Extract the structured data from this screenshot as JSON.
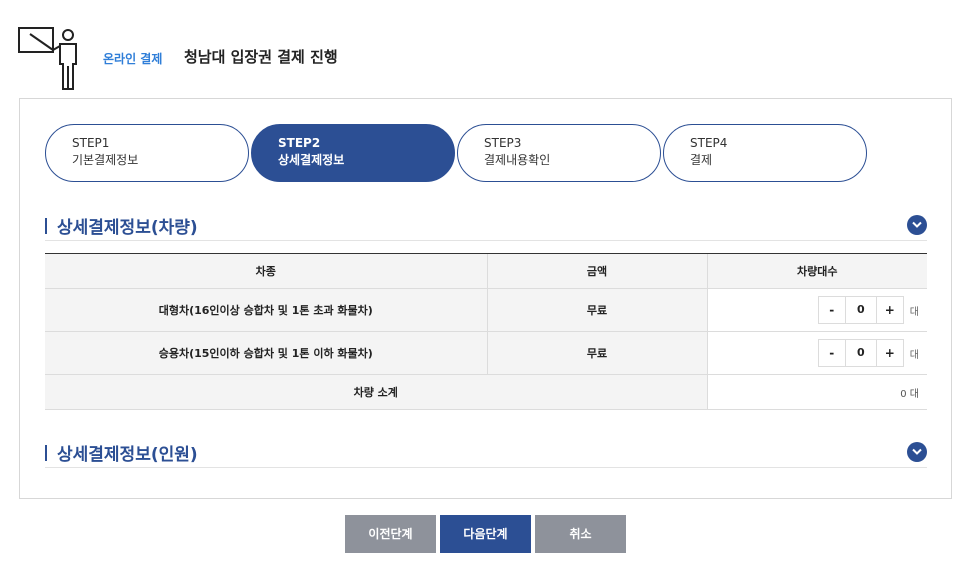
{
  "header": {
    "crumb": "온라인 결제",
    "title": "청남대 입장권 결제 진행"
  },
  "steps": [
    {
      "num": "STEP1",
      "name": "기본결제정보",
      "active": false
    },
    {
      "num": "STEP2",
      "name": "상세결제정보",
      "active": true
    },
    {
      "num": "STEP3",
      "name": "결제내용확인",
      "active": false
    },
    {
      "num": "STEP4",
      "name": "결제",
      "active": false
    }
  ],
  "vehicle_section": {
    "title": "상세결제정보(차량)",
    "columns": [
      "차종",
      "금액",
      "차량대수"
    ],
    "rows": [
      {
        "type": "대형차(16인이상 승합차 및 1톤 초과 화물차)",
        "price": "무료",
        "count": "0",
        "unit": "대"
      },
      {
        "type": "승용차(15인이하 승합차 및 1톤 이하 화물차)",
        "price": "무료",
        "count": "0",
        "unit": "대"
      }
    ],
    "subtotal_label": "차량 소계",
    "subtotal_value": "0 대",
    "minus": "-",
    "plus": "+"
  },
  "person_section": {
    "title": "상세결제정보(인원)"
  },
  "actions": {
    "prev": "이전단계",
    "next": "다음단계",
    "cancel": "취소"
  },
  "colors": {
    "primary": "#2c4f94",
    "link": "#2f7ed8",
    "gray_button": "#8e929b"
  },
  "icons": {
    "logo": "presenter-board-icon",
    "toggle": "chevron-down-icon"
  }
}
